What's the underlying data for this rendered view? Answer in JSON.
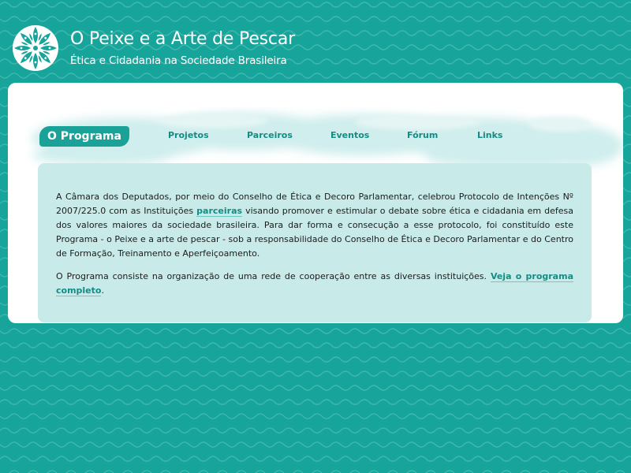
{
  "header": {
    "title": "O Peixe e a Arte de Pescar",
    "subtitle": "Ética e Cidadania na Sociedade Brasileira",
    "logo_icon": "fish-rosette-icon"
  },
  "nav": {
    "items": [
      {
        "label": "O Programa",
        "active": true
      },
      {
        "label": "Projetos"
      },
      {
        "label": "Parceiros"
      },
      {
        "label": "Eventos"
      },
      {
        "label": "Fórum"
      },
      {
        "label": "Links"
      }
    ]
  },
  "content": {
    "p1_before_link": "A Câmara dos Deputados, por meio do Conselho de Ética e Decoro Parlamentar, celebrou Protocolo de Intenções Nº 2007/225.0 com as Instituições ",
    "p1_link": "parceiras",
    "p1_after_link": " visando promover e estimular o debate sobre ética e cidadania em defesa dos valores maiores da sociedade brasileira. Para dar forma e consecução a esse protocolo, foi constituído este Programa - o Peixe e a arte de pescar - sob a responsabilidade do Conselho de Ética e Decoro Parlamentar e do Centro de Formação, Treinamento e Aperfeiçoamento.",
    "p2_before_link": "O Programa consiste na organização de uma rede de cooperação entre as diversas instituições. ",
    "p2_link": "Veja o programa completo",
    "p2_after_link": "."
  },
  "colors": {
    "background": "#17a59b",
    "panel": "#ffffff",
    "text_box": "#c8ebe9",
    "link": "#138c84",
    "nav_active_bg": "#1aa198"
  }
}
